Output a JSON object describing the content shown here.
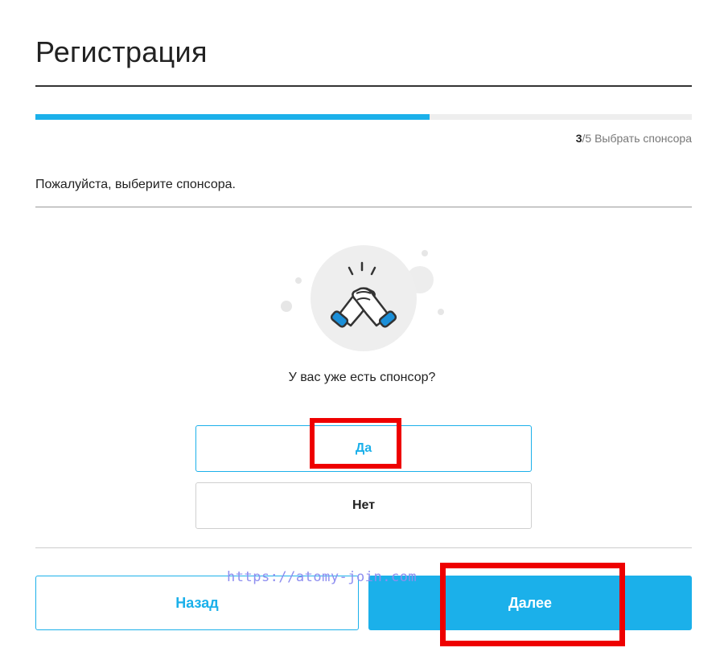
{
  "page": {
    "title": "Регистрация",
    "instruction": "Пожалуйста, выберите спонсора."
  },
  "progress": {
    "current": "3",
    "rest": "/5 Выбрать спонсора",
    "fraction": 0.6
  },
  "illustration": {
    "icon": "handshake-icon"
  },
  "question": "У вас уже есть спонсор?",
  "options": {
    "yes": "Да",
    "no": "Нет"
  },
  "buttons": {
    "back": "Назад",
    "next": "Далее"
  },
  "watermark": "https://atomy-join.com",
  "colors": {
    "accent": "#1bb0ea",
    "highlight": "#ee0000"
  }
}
